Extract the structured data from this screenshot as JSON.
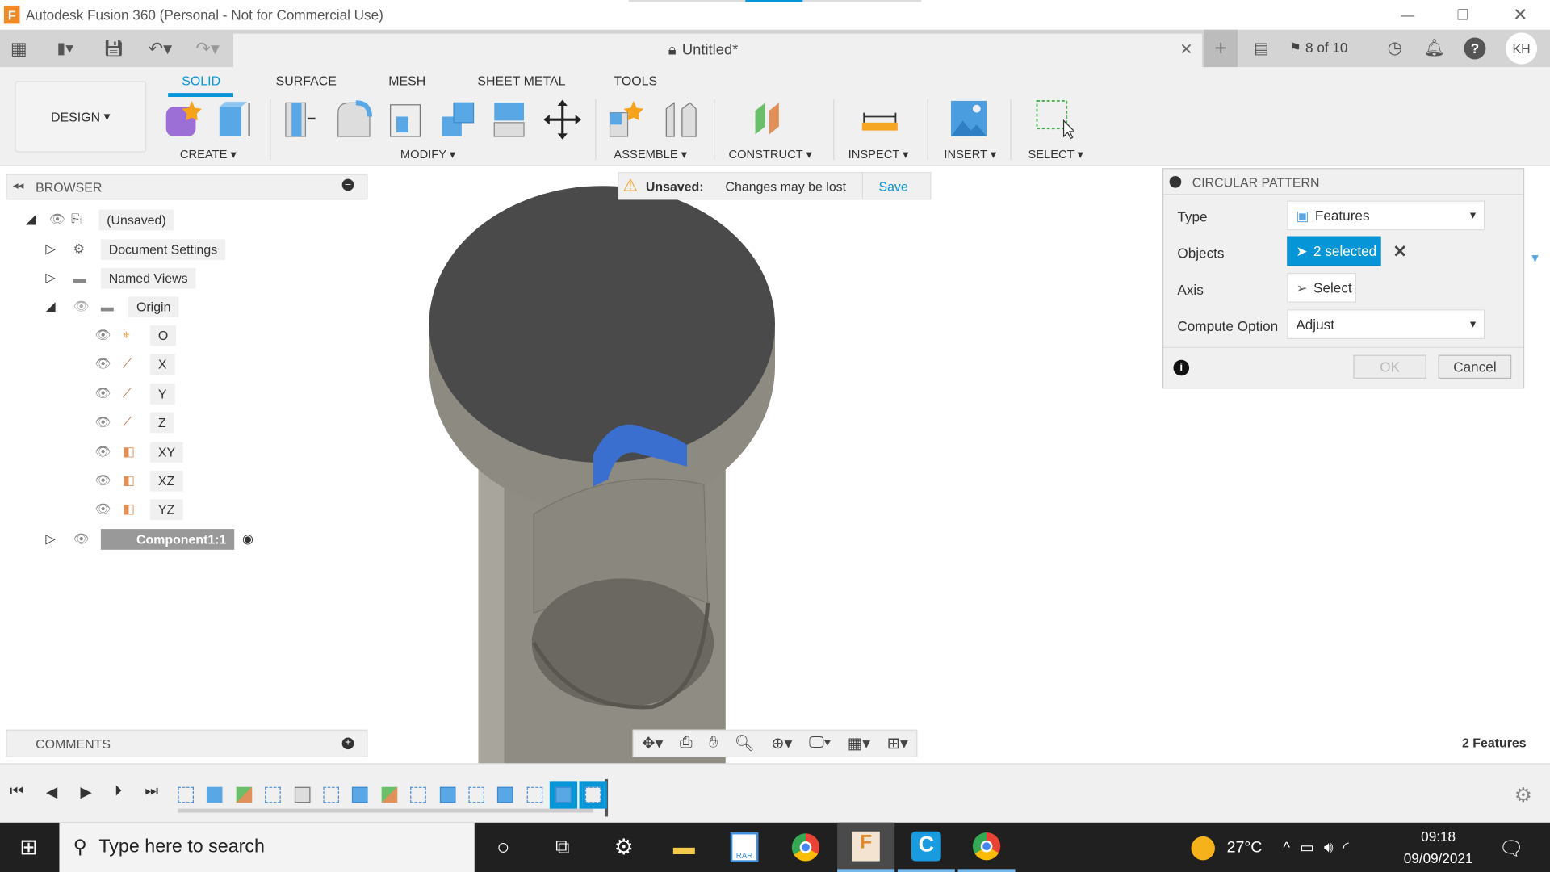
{
  "window": {
    "title": "Autodesk Fusion 360 (Personal - Not for Commercial Use)"
  },
  "appbar": {
    "doc_title": "Untitled*",
    "job_status": "8 of 10",
    "user_initials": "KH"
  },
  "ribbon": {
    "workspace": "DESIGN",
    "tabs": [
      "SOLID",
      "SURFACE",
      "MESH",
      "SHEET METAL",
      "TOOLS"
    ],
    "active_tab": "SOLID",
    "groups": [
      "CREATE",
      "MODIFY",
      "ASSEMBLE",
      "CONSTRUCT",
      "INSPECT",
      "INSERT",
      "SELECT"
    ]
  },
  "banner": {
    "label": "Unsaved:",
    "message": "Changes may be lost",
    "save": "Save"
  },
  "browser": {
    "title": "BROWSER",
    "items": [
      {
        "label": "(Unsaved)"
      },
      {
        "label": "Document Settings"
      },
      {
        "label": "Named Views"
      },
      {
        "label": "Origin"
      },
      {
        "label": "O"
      },
      {
        "label": "X"
      },
      {
        "label": "Y"
      },
      {
        "label": "Z"
      },
      {
        "label": "XY"
      },
      {
        "label": "XZ"
      },
      {
        "label": "YZ"
      },
      {
        "label": "Component1:1"
      }
    ]
  },
  "comments": {
    "title": "COMMENTS"
  },
  "dialog": {
    "title": "CIRCULAR PATTERN",
    "type_label": "Type",
    "type_value": "Features",
    "objects_label": "Objects",
    "objects_value": "2 selected",
    "axis_label": "Axis",
    "axis_value": "Select",
    "compute_label": "Compute Option",
    "compute_value": "Adjust",
    "ok": "OK",
    "cancel": "Cancel"
  },
  "status": {
    "selection": "2 Features"
  },
  "taskbar": {
    "search_placeholder": "Type here to search",
    "temperature": "27°C",
    "time": "09:18",
    "date": "09/09/2021"
  },
  "colors": {
    "accent": "#0696d7",
    "model": "#8f8c84",
    "model_top": "#4a4a4a",
    "selected_feature": "#3a6fd0"
  }
}
